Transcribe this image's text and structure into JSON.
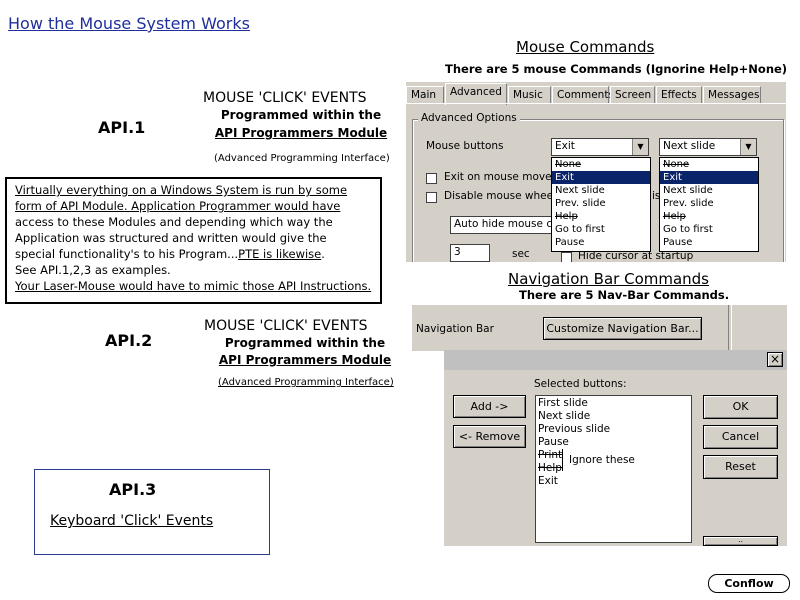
{
  "page": {
    "title": "How the Mouse System Works",
    "conflow_label": "Conflow"
  },
  "api1": {
    "label": "API.1",
    "event_title": "MOUSE 'CLICK' EVENTS",
    "prog_line1": "Programmed within the",
    "prog_line2": "API Programmers Module",
    "note": "(Advanced Programming Interface)"
  },
  "api2": {
    "label": "API.2",
    "event_title": "MOUSE 'CLICK' EVENTS",
    "prog_line1": "Programmed within the",
    "prog_line2": "API Programmers Module",
    "note": "(Advanced Programming Interface)"
  },
  "api3": {
    "label": "API.3",
    "link": "Keyboard 'Click' Events"
  },
  "explanation": {
    "line1": "Virtually everything on a Windows System is run by some",
    "line2": "form of API Module. Application Programmer would have",
    "line3": "access to these Modules and depending which way the",
    "line4": "Application was structured and written would give the",
    "line5a": "special functionality's to his Program...",
    "line5b": "PTE is likewise",
    "line5c": ".",
    "line6": "See API.1,2,3 as examples.",
    "line7": "Your Laser-Mouse would have to mimic those API Instructions."
  },
  "mouse_commands": {
    "title": "Mouse Commands",
    "subtitle": "There are 5 mouse Commands (Ignorine Help+None)"
  },
  "settings_dialog": {
    "tabs": [
      "Main",
      "Advanced",
      "Music",
      "Comments",
      "Screen",
      "Effects",
      "Messages"
    ],
    "active_tab": "Advanced",
    "group_label": "Advanced Options",
    "mouse_buttons_label": "Mouse buttons",
    "combo_left_value": "Exit",
    "combo_right_value": "Next slide",
    "options_left": [
      "None",
      "Exit",
      "Next slide",
      "Prev. slide",
      "Help",
      "Go to first",
      "Pause"
    ],
    "options_right": [
      "None",
      "Exit",
      "Next slide",
      "Prev. slide",
      "Help",
      "Go to first",
      "Pause"
    ],
    "check_exit_label": "Exit on mouse move (f",
    "check_disable_label": "Disable mouse wheel",
    "autohide_value": "Auto hide mouse cur",
    "spin_value": "3",
    "sec_label": "sec",
    "hide_cursor_label": "Hide cursor at startup",
    "partial_text": "is"
  },
  "nav_commands": {
    "title": "Navigation Bar Commands",
    "subtitle": "There are 5 Nav-Bar Commands."
  },
  "nav_dialog": {
    "nav_bar_label": "Navigation Bar",
    "customize_button": "Customize Navigation Bar...",
    "close_symbol": "×",
    "selected_label": "Selected buttons:",
    "add_button": "Add ->",
    "remove_button": "<- Remove",
    "ok_button": "OK",
    "cancel_button": "Cancel",
    "reset_button": "Reset",
    "selected_items": [
      "First slide",
      "Next slide",
      "Previous slide",
      "Pause",
      "Print",
      "Help",
      "Exit"
    ],
    "ignore_note": "Ignore these",
    "partial_button": ".."
  }
}
